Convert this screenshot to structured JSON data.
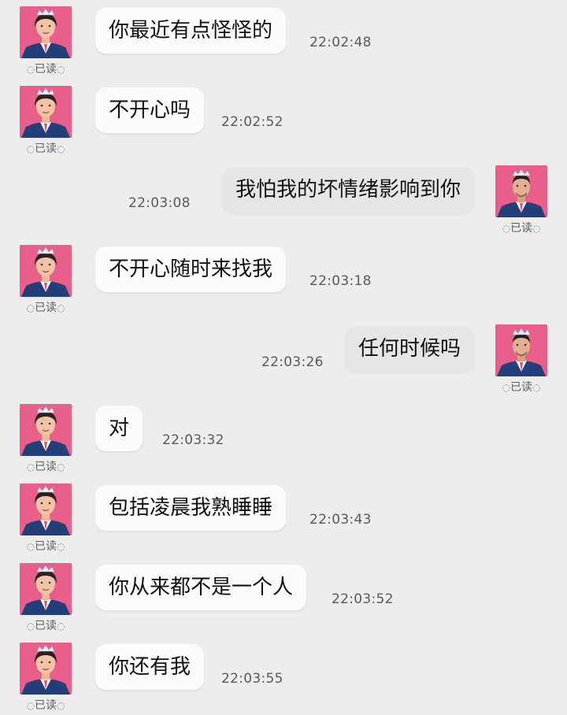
{
  "read_label": "已读",
  "colors": {
    "background": "#ededed",
    "incoming_bubble": "#fbfbfb",
    "outgoing_bubble": "#e6e6e6",
    "avatar_bg": "#e85f8c"
  },
  "messages": [
    {
      "side": "left",
      "text": "你最近有点怪怪的",
      "time": "22:02:48"
    },
    {
      "side": "left",
      "text": "不开心吗",
      "time": "22:02:52"
    },
    {
      "side": "right",
      "text": "我怕我的坏情绪影响到你",
      "time": "22:03:08"
    },
    {
      "side": "left",
      "text": "不开心随时来找我",
      "time": "22:03:18"
    },
    {
      "side": "right",
      "text": "任何时候吗",
      "time": "22:03:26"
    },
    {
      "side": "left",
      "text": "对",
      "time": "22:03:32"
    },
    {
      "side": "left",
      "text": "包括凌晨我熟睡睡",
      "time": "22:03:43"
    },
    {
      "side": "left",
      "text": "你从来都不是一个人",
      "time": "22:03:52"
    },
    {
      "side": "left",
      "text": "你还有我",
      "time": "22:03:55"
    }
  ]
}
